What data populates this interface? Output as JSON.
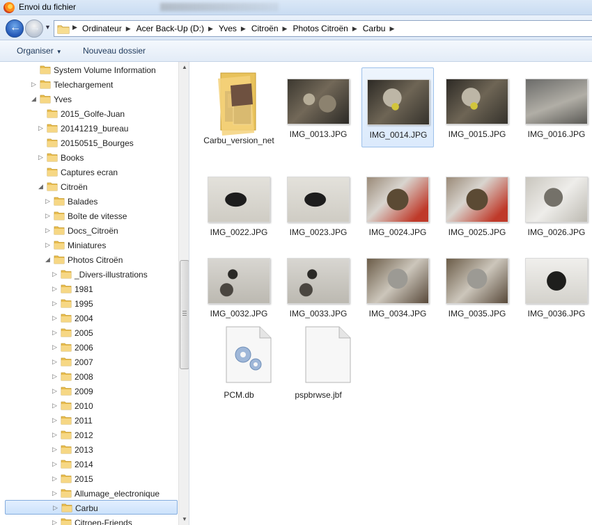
{
  "window": {
    "title": "Envoi du fichier"
  },
  "address": {
    "crumbs": [
      "Ordinateur",
      "Acer Back-Up (D:)",
      "Yves",
      "Citroën",
      "Photos Citroën",
      "Carbu"
    ]
  },
  "toolbar": {
    "organize_label": "Organiser",
    "new_folder_label": "Nouveau dossier"
  },
  "tree": [
    {
      "label": "System Volume Information",
      "level": 2,
      "arrow": ""
    },
    {
      "label": "Telechargement",
      "level": 2,
      "arrow": "collapsed"
    },
    {
      "label": "Yves",
      "level": 2,
      "arrow": "expanded"
    },
    {
      "label": "2015_Golfe-Juan",
      "level": 3,
      "arrow": ""
    },
    {
      "label": "20141219_bureau",
      "level": 3,
      "arrow": "collapsed"
    },
    {
      "label": "20150515_Bourges",
      "level": 3,
      "arrow": ""
    },
    {
      "label": "Books",
      "level": 3,
      "arrow": "collapsed"
    },
    {
      "label": "Captures ecran",
      "level": 3,
      "arrow": ""
    },
    {
      "label": "Citroën",
      "level": 3,
      "arrow": "expanded"
    },
    {
      "label": "Balades",
      "level": 4,
      "arrow": "collapsed"
    },
    {
      "label": "Boîte de vitesse",
      "level": 4,
      "arrow": "collapsed"
    },
    {
      "label": "Docs_Citroën",
      "level": 4,
      "arrow": "collapsed"
    },
    {
      "label": "Miniatures",
      "level": 4,
      "arrow": "collapsed"
    },
    {
      "label": "Photos Citroën",
      "level": 4,
      "arrow": "expanded"
    },
    {
      "label": "_Divers-illustrations",
      "level": 5,
      "arrow": "collapsed"
    },
    {
      "label": "1981",
      "level": 5,
      "arrow": "collapsed"
    },
    {
      "label": "1995",
      "level": 5,
      "arrow": "collapsed"
    },
    {
      "label": "2004",
      "level": 5,
      "arrow": "collapsed"
    },
    {
      "label": "2005",
      "level": 5,
      "arrow": "collapsed"
    },
    {
      "label": "2006",
      "level": 5,
      "arrow": "collapsed"
    },
    {
      "label": "2007",
      "level": 5,
      "arrow": "collapsed"
    },
    {
      "label": "2008",
      "level": 5,
      "arrow": "collapsed"
    },
    {
      "label": "2009",
      "level": 5,
      "arrow": "collapsed"
    },
    {
      "label": "2010",
      "level": 5,
      "arrow": "collapsed"
    },
    {
      "label": "2011",
      "level": 5,
      "arrow": "collapsed"
    },
    {
      "label": "2012",
      "level": 5,
      "arrow": "collapsed"
    },
    {
      "label": "2013",
      "level": 5,
      "arrow": "collapsed"
    },
    {
      "label": "2014",
      "level": 5,
      "arrow": "collapsed"
    },
    {
      "label": "2015",
      "level": 5,
      "arrow": "collapsed"
    },
    {
      "label": "Allumage_electronique",
      "level": 5,
      "arrow": "collapsed"
    },
    {
      "label": "Carbu",
      "level": 5,
      "arrow": "collapsed",
      "selected": true
    },
    {
      "label": "Citroen-Friends",
      "level": 5,
      "arrow": "collapsed"
    }
  ],
  "files": [
    {
      "name": "Carbu_version_net",
      "kind": "folder"
    },
    {
      "name": "IMG_0013.JPG",
      "kind": "image",
      "style": "ph-a"
    },
    {
      "name": "IMG_0014.JPG",
      "kind": "image",
      "style": "ph-b",
      "selected": true
    },
    {
      "name": "IMG_0015.JPG",
      "kind": "image",
      "style": "ph-b"
    },
    {
      "name": "IMG_0016.JPG",
      "kind": "image",
      "style": "ph-c"
    },
    {
      "name": "IMG_0022.JPG",
      "kind": "image",
      "style": "ph-d"
    },
    {
      "name": "IMG_0023.JPG",
      "kind": "image",
      "style": "ph-d"
    },
    {
      "name": "IMG_0024.JPG",
      "kind": "image",
      "style": "ph-e"
    },
    {
      "name": "IMG_0025.JPG",
      "kind": "image",
      "style": "ph-e"
    },
    {
      "name": "IMG_0026.JPG",
      "kind": "image",
      "style": "ph-f"
    },
    {
      "name": "IMG_0032.JPG",
      "kind": "image",
      "style": "ph-g"
    },
    {
      "name": "IMG_0033.JPG",
      "kind": "image",
      "style": "ph-g"
    },
    {
      "name": "IMG_0034.JPG",
      "kind": "image",
      "style": "ph-h"
    },
    {
      "name": "IMG_0035.JPG",
      "kind": "image",
      "style": "ph-h"
    },
    {
      "name": "IMG_0036.JPG",
      "kind": "image",
      "style": "ph-i"
    },
    {
      "name": "PCM.db",
      "kind": "system-file"
    },
    {
      "name": "pspbrwse.jbf",
      "kind": "blank-file"
    }
  ]
}
